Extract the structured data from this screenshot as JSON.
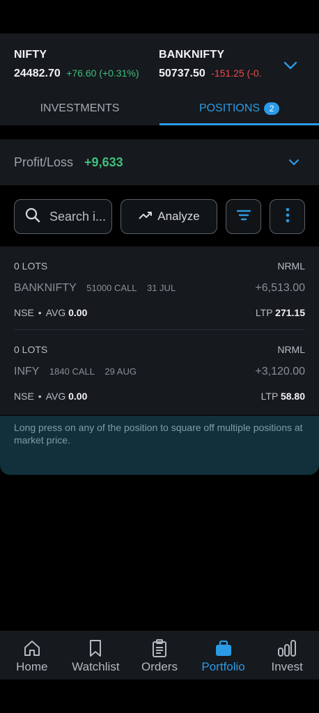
{
  "indices": [
    {
      "name": "NIFTY",
      "price": "24482.70",
      "change": "+76.60 (+0.31%)",
      "direction": "up"
    },
    {
      "name": "BANKNIFTY",
      "price": "50737.50",
      "change": "-151.25 (-0.",
      "direction": "down"
    }
  ],
  "tabs": [
    {
      "label": "INVESTMENTS",
      "active": false
    },
    {
      "label": "POSITIONS",
      "badge": "2",
      "active": true
    }
  ],
  "profit_loss": {
    "label": "Profit/Loss",
    "value": "+9,633"
  },
  "toolbar": {
    "search_placeholder": "Search i...",
    "analyze_label": "Analyze"
  },
  "positions": [
    {
      "lots": "0 LOTS",
      "product": "NRML",
      "symbol": "BANKNIFTY",
      "strike": "51000 CALL",
      "expiry": "31 JUL",
      "pnl": "+6,513.00",
      "exchange": "NSE",
      "avg_label": "AVG",
      "avg": "0.00",
      "ltp_label": "LTP",
      "ltp": "271.15"
    },
    {
      "lots": "0 LOTS",
      "product": "NRML",
      "symbol": "INFY",
      "strike": "1840 CALL",
      "expiry": "29 AUG",
      "pnl": "+3,120.00",
      "exchange": "NSE",
      "avg_label": "AVG",
      "avg": "0.00",
      "ltp_label": "LTP",
      "ltp": "58.80"
    }
  ],
  "hint": "Long press on any of the position to square off multiple positions at market price.",
  "bottom_nav": [
    {
      "label": "Home",
      "icon": "home-icon",
      "active": false
    },
    {
      "label": "Watchlist",
      "icon": "bookmark-icon",
      "active": false
    },
    {
      "label": "Orders",
      "icon": "clipboard-icon",
      "active": false
    },
    {
      "label": "Portfolio",
      "icon": "briefcase-icon",
      "active": true
    },
    {
      "label": "Invest",
      "icon": "invest-bars-icon",
      "active": false
    }
  ],
  "colors": {
    "accent": "#2c9be6",
    "gain": "#3fbf7f",
    "loss": "#ef4b4b",
    "background": "#000000",
    "card": "#16191d"
  }
}
